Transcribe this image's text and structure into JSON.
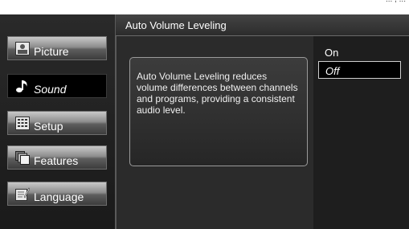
{
  "top_strip_text": "... , ...",
  "header": {
    "title": "Auto Volume Leveling"
  },
  "menu": {
    "items": [
      {
        "label": "Picture",
        "icon": "picture-icon"
      },
      {
        "label": "Sound",
        "icon": "note-icon"
      },
      {
        "label": "Setup",
        "icon": "grid-icon"
      },
      {
        "label": "Features",
        "icon": "stack-icon"
      },
      {
        "label": "Language",
        "icon": "language-icon"
      }
    ],
    "selected": "Sound"
  },
  "description": "Auto Volume Leveling reduces volume differences between channels and programs, providing a consistent audio level.",
  "options": [
    {
      "label": "On"
    },
    {
      "label": "Off"
    }
  ],
  "selected_option": "Off",
  "colors": {
    "background": "#1e1e1e",
    "highlight_border": "#cfcfcf"
  }
}
